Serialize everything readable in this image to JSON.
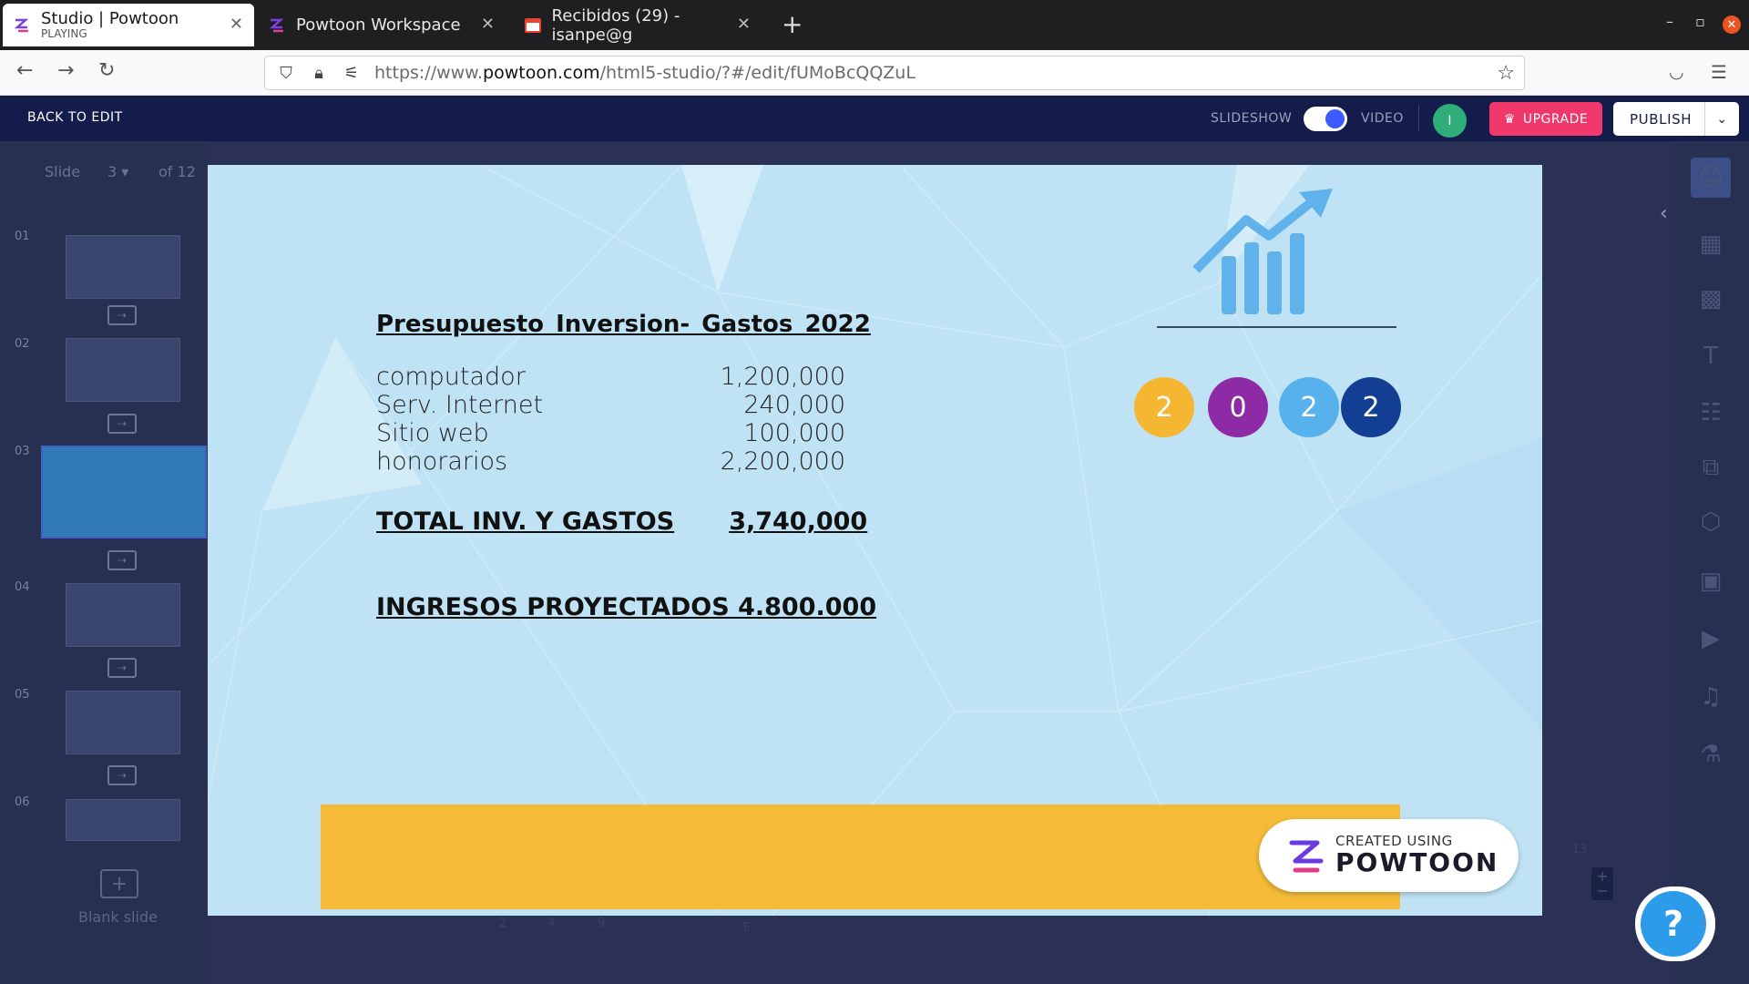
{
  "browser": {
    "tabs": [
      {
        "title": "Studio | Powtoon",
        "subtitle": "PLAYING"
      },
      {
        "title": "Powtoon Workspace"
      },
      {
        "title": "Recibidos (29) - isanpe@g"
      }
    ],
    "url_prefix": "https://www.",
    "url_host": "powtoon.com",
    "url_path": "/html5-studio/?#/edit/fUMoBcQQZuL"
  },
  "appbar": {
    "back_label": "BACK TO EDIT",
    "slideshow_label": "SLIDESHOW",
    "video_label": "VIDEO",
    "avatar_initial": "I",
    "upgrade_label": "UPGRADE",
    "publish_label": "PUBLISH"
  },
  "left_panel": {
    "slide_label": "Slide",
    "current_slide": "3",
    "total_label": "of 12",
    "slide_numbers": [
      "01",
      "02",
      "03",
      "04",
      "05",
      "06"
    ],
    "blank_slide_label": "Blank slide"
  },
  "slide": {
    "title": "Presupuesto  Inversion- Gastos  2022",
    "rows": [
      {
        "label": "computador",
        "value": "1,200,000"
      },
      {
        "label": "Serv. Internet",
        "value": "240,000"
      },
      {
        "label": "Sitio web",
        "value": "100,000"
      },
      {
        "label": "honorarios",
        "value": "2,200,000"
      }
    ],
    "total_label": "TOTAL INV.  Y GASTOS",
    "total_value": "3,740,000",
    "income_label": "INGRESOS PROYECTADOS   4.800.000",
    "year_digits": [
      "2",
      "0",
      "2",
      "2"
    ],
    "year_colors": [
      "#f5b731",
      "#8f2aa6",
      "#56b1ec",
      "#123e94"
    ],
    "badge_small": "CREATED USING",
    "badge_big": "POWTOON"
  },
  "timeline": {
    "markers": [
      "2",
      "4",
      "9",
      "E"
    ],
    "right_marker": "13"
  },
  "colors": {
    "app_navy": "#131c4a",
    "upgrade_pink": "#f0386b",
    "slide_bg": "#bfe3f5",
    "bar_yellow": "#f5bb38"
  }
}
